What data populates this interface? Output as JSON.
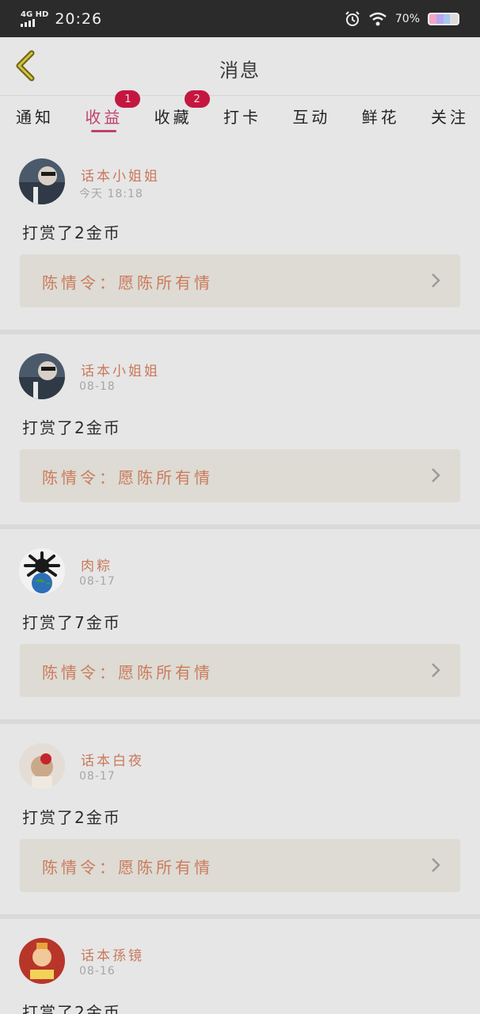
{
  "status_bar": {
    "network": "4G HD",
    "time": "20:26",
    "battery": "70%",
    "icons": [
      "signal-icon",
      "alarm-icon",
      "wifi-icon",
      "battery-icon"
    ]
  },
  "header": {
    "title": "消息",
    "back_icon": "back-arrow-icon"
  },
  "tabs": [
    {
      "label": "通知",
      "badge": ""
    },
    {
      "label": "收益",
      "badge": "1"
    },
    {
      "label": "收藏",
      "badge": "2"
    },
    {
      "label": "打卡",
      "badge": ""
    },
    {
      "label": "互动",
      "badge": ""
    },
    {
      "label": "鲜花",
      "badge": ""
    },
    {
      "label": "关注",
      "badge": ""
    }
  ],
  "active_tab": "收益",
  "feed": [
    {
      "user": "话本小姐姐",
      "time": "今天 18:18",
      "action": "打赏了2金币",
      "work": "陈情令：愿陈所有情"
    },
    {
      "user": "话本小姐姐",
      "time": "08-18",
      "action": "打赏了2金币",
      "work": "陈情令：愿陈所有情"
    },
    {
      "user": "肉粽",
      "time": "08-17",
      "action": "打赏了7金币",
      "work": "陈情令：愿陈所有情"
    },
    {
      "user": "话本白夜",
      "time": "08-17",
      "action": "打赏了2金币",
      "work": "陈情令：愿陈所有情"
    },
    {
      "user": "话本孫镜",
      "time": "08-16",
      "action": "打赏了2金币",
      "work": ""
    }
  ],
  "colors": {
    "accent": "#c0426a",
    "badge": "#c4173f",
    "username": "#c9785a",
    "work_title": "#cc7a5c",
    "link_bg": "#dddbd3",
    "overlay_bg": "#e6e6e6"
  }
}
